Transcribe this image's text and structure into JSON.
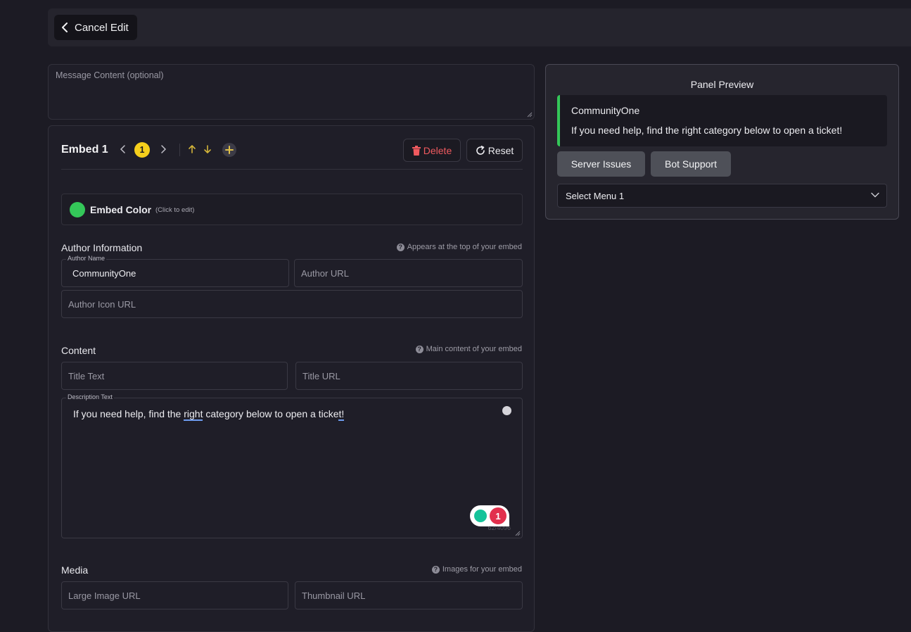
{
  "header": {
    "cancel_label": "Cancel Edit"
  },
  "message": {
    "placeholder": "Message Content (optional)"
  },
  "embed": {
    "title": "Embed 1",
    "index": "1",
    "delete_label": "Delete",
    "reset_label": "Reset",
    "color": {
      "label": "Embed Color",
      "hint": "(Click to edit)",
      "value": "#34c759"
    },
    "author": {
      "section_title": "Author Information",
      "hint": "Appears at the top of your embed",
      "name_label": "Author Name",
      "name_value": "CommunityOne",
      "url_placeholder": "Author URL",
      "icon_placeholder": "Author Icon URL"
    },
    "content": {
      "section_title": "Content",
      "hint": "Main content of your embed",
      "title_placeholder": "Title Text",
      "title_url_placeholder": "Title URL",
      "description_label": "Description Text",
      "description_parts": [
        "If you need help, find the ",
        "right",
        " category below to open a ticke",
        "t!"
      ],
      "char_counter": "62/4096",
      "grammar_count": "1"
    },
    "media": {
      "section_title": "Media",
      "hint": "Images for your embed",
      "large_image_placeholder": "Large Image URL",
      "thumbnail_placeholder": "Thumbnail URL"
    }
  },
  "preview": {
    "title": "Panel Preview",
    "author": "CommunityOne",
    "description": "If you need help, find the right category below to open a ticket!",
    "buttons": [
      "Server Issues",
      "Bot Support"
    ],
    "select_value": "Select Menu 1"
  }
}
